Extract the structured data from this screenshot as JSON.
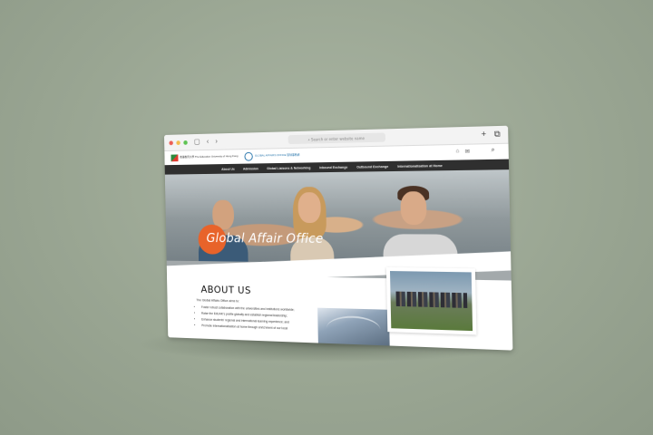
{
  "browser": {
    "address_placeholder": "Search or enter website name",
    "icons": [
      "sidebar-icon",
      "back-icon",
      "forward-icon",
      "new-tab-icon",
      "tabs-icon"
    ]
  },
  "header": {
    "logo_primary_text": "香港教育大學 The Education University of Hong Kong",
    "logo_secondary_text": "GLOBAL AFFAIRS OFFICE 環球事務處",
    "icons": [
      "home-icon",
      "mail-icon",
      "search-icon"
    ]
  },
  "nav": {
    "items": [
      "About Us",
      "Admission",
      "Global Liaisons & Networking",
      "Inbound Exchange",
      "Outbound Exchange",
      "Internationalisation at Home"
    ]
  },
  "hero": {
    "title": "Global Affair Office",
    "accent_color": "#e8632a",
    "slide_count": 4,
    "active_slide": 1
  },
  "about": {
    "title": "ABOUT US",
    "intro": "The Global Affairs Office aims to:",
    "bullets": [
      "Foster robust collaboration with the universities and institutions worldwide;",
      "Raise the EdUHK's profile globally and establish regional leadership;",
      "Enhance students' regional and international learning experience; and",
      "Promote internationalisation at home through enrichment of our local"
    ]
  }
}
